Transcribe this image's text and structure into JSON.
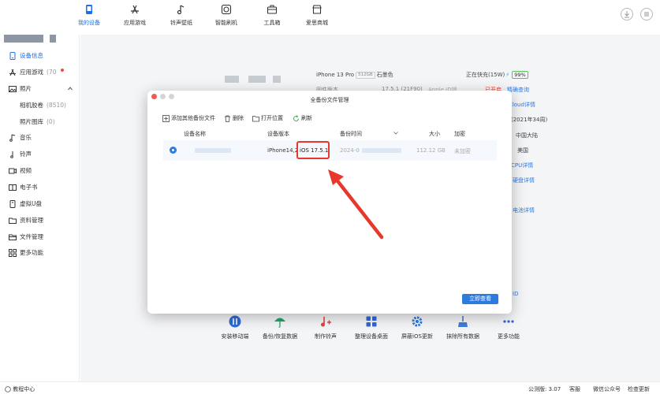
{
  "nav": {
    "items": [
      {
        "label": "我的设备",
        "icon": "phone-icon"
      },
      {
        "label": "应用游戏",
        "icon": "app-store-icon"
      },
      {
        "label": "铃声壁纸",
        "icon": "music-note-icon"
      },
      {
        "label": "智能刷机",
        "icon": "flash-icon"
      },
      {
        "label": "工具箱",
        "icon": "toolbox-icon"
      },
      {
        "label": "爱思商城",
        "icon": "shop-icon"
      }
    ],
    "active_color": "#1f6fe5"
  },
  "sidebar": {
    "items": [
      {
        "label": "设备信息",
        "icon": "device-info-icon"
      },
      {
        "label": "应用游戏",
        "count": "(70",
        "icon": "apps-icon"
      },
      {
        "label": "照片",
        "icon": "photo-icon"
      },
      {
        "label": "相机胶卷",
        "count": "(8510)"
      },
      {
        "label": "照片图库",
        "count": "(0)"
      },
      {
        "label": "音乐",
        "icon": "music-icon"
      },
      {
        "label": "铃声",
        "icon": "ringtone-icon"
      },
      {
        "label": "视频",
        "icon": "video-icon"
      },
      {
        "label": "电子书",
        "icon": "ebook-icon"
      },
      {
        "label": "虚拟U盘",
        "icon": "usb-icon"
      },
      {
        "label": "资料管理",
        "icon": "folder-icon"
      },
      {
        "label": "文件管理",
        "icon": "file-icon"
      },
      {
        "label": "更多功能",
        "icon": "grid-icon"
      }
    ]
  },
  "device": {
    "model": "iPhone 13 Pro",
    "storage": "512GB",
    "color": "石墨色",
    "charging": "正在快充(15W)",
    "battery": "99%",
    "fw_label": "固件版本",
    "fw_value": "17.5.1 (21F90)",
    "apple_id": "Apple ID锁",
    "status": "已开启",
    "link_accuracy": "精确查询",
    "link_icloud": "iCloud详情",
    "week": "(2021年34周)",
    "region": "中国大陆",
    "country": "美国",
    "link_cpu": "CPU详情",
    "link_disk": "硬盘详情",
    "link_battery": "电池详情",
    "id_tail": "ID"
  },
  "tools": [
    {
      "label": "安装移动端",
      "icon": "install-icon"
    },
    {
      "label": "备份/恢复数据",
      "icon": "umbrella-icon"
    },
    {
      "label": "制作铃声",
      "icon": "ringtone-make-icon"
    },
    {
      "label": "整理设备桌面",
      "icon": "desktop-grid-icon"
    },
    {
      "label": "屏蔽iOS更新",
      "icon": "gear-icon"
    },
    {
      "label": "抹除所有数据",
      "icon": "broom-icon"
    },
    {
      "label": "更多功能",
      "icon": "more-icon"
    }
  ],
  "footer": {
    "tutorial": "教程中心",
    "version": "公测版: 3.07",
    "support": "客服",
    "wechat": "微信公众号",
    "update": "检查更新"
  },
  "modal": {
    "title": "全备份文件管理",
    "toolbar": {
      "add": "添加其他备份文件",
      "delete": "删除",
      "open": "打开位置",
      "refresh": "刷新"
    },
    "columns": [
      "设备名称",
      "设备版本",
      "备份时间",
      "大小",
      "加密"
    ],
    "row": {
      "device_version": "iPhone14,2",
      "ios": "iOS 17.5.1",
      "time": "2024-0",
      "size": "112.12 GB",
      "encrypted": "未加密"
    },
    "confirm": "立即查看"
  },
  "colors": {
    "accent": "#2e7be0",
    "highlight": "#e8382c"
  }
}
